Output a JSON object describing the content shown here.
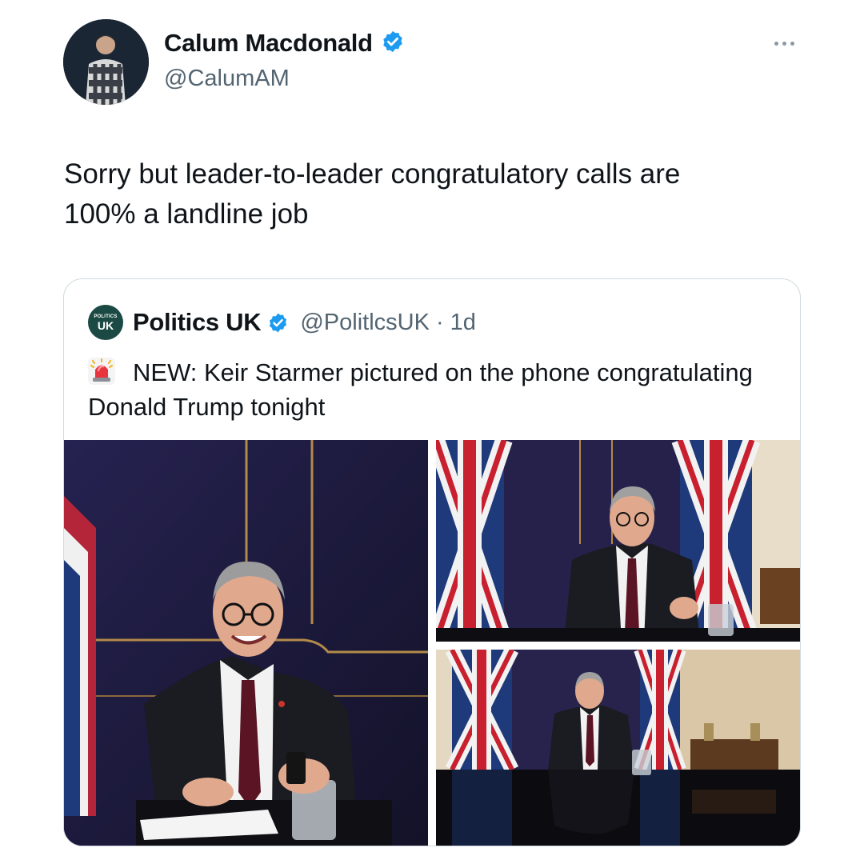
{
  "author": {
    "display_name": "Calum Macdonald",
    "handle": "@CalumAM",
    "verified_icon": "verified-badge-icon",
    "avatar_icon": "profile-photo"
  },
  "tweet": {
    "text": "Sorry but leader-to-leader congratulatory calls are\n100% a landline job"
  },
  "menu": {
    "more_icon": "more-horizontal-icon"
  },
  "quote": {
    "avatar_small": "POLITICS",
    "avatar_big": "UK",
    "display_name": "Politics UK",
    "handle": "@PolitlcsUK",
    "separator": "·",
    "time": "1d",
    "text": "NEW: Keir Starmer pictured on the phone congratulating Donald Trump tonight",
    "siren_icon": "police-siren-icon",
    "photos": [
      "photo-starmer-smiling",
      "photo-starmer-flags",
      "photo-starmer-wide-table"
    ]
  },
  "colors": {
    "verified_blue": "#1d9bf0",
    "secondary_text": "#536471",
    "border": "#cfd9de",
    "politicsuk_green": "#1b4a44"
  }
}
